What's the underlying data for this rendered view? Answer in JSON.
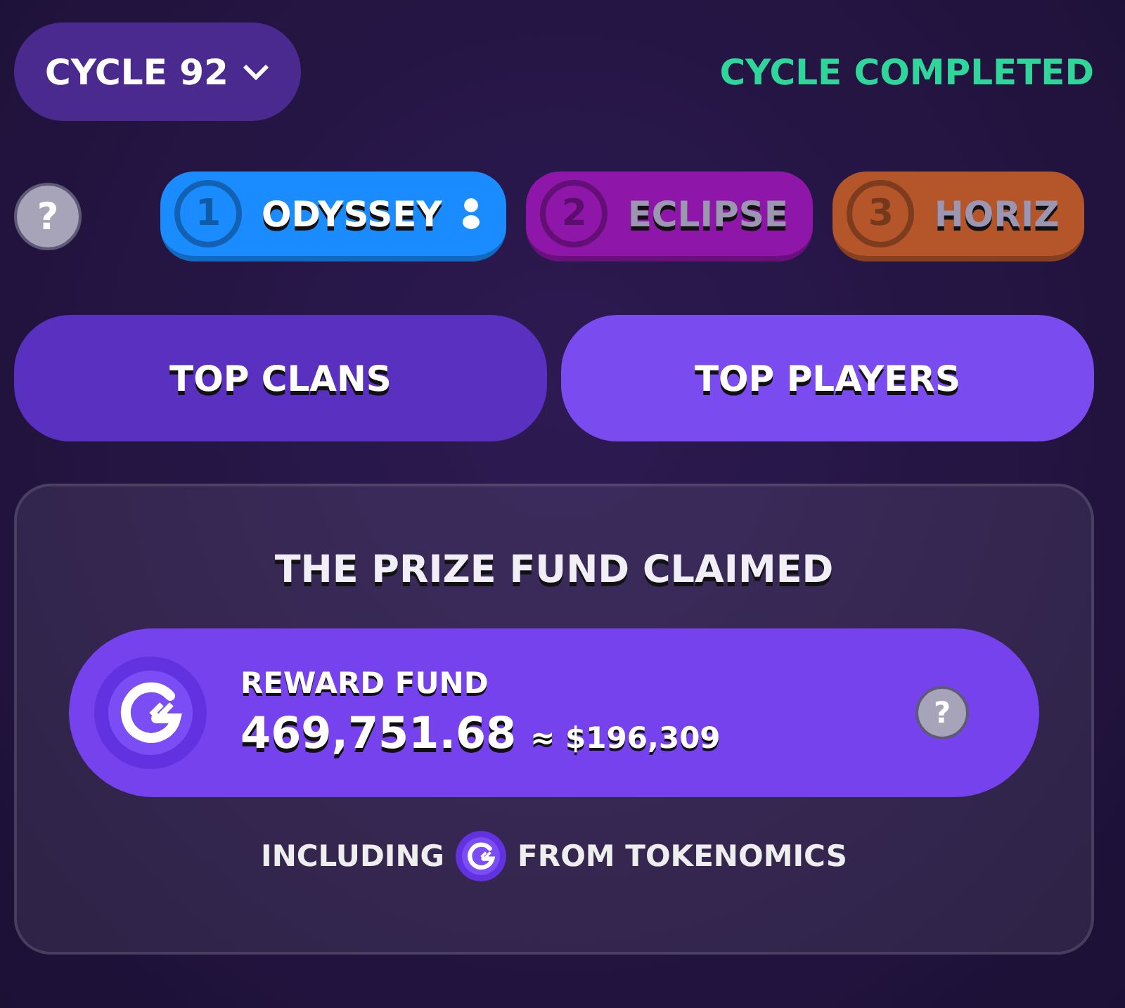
{
  "cycle": {
    "label": "CYCLE 92",
    "status": "CYCLE COMPLETED"
  },
  "help": "?",
  "leagues": [
    {
      "number": "1",
      "name": "ODYSSEY",
      "color": "#1a8cff",
      "selected": true
    },
    {
      "number": "2",
      "name": "ECLIPSE",
      "color": "#8e16a8",
      "selected": false
    },
    {
      "number": "3",
      "name": "HORIZ",
      "color": "#b4562a",
      "selected": false
    }
  ],
  "toggle": [
    {
      "label": "TOP CLANS",
      "selected": false
    },
    {
      "label": "TOP PLAYERS",
      "selected": true
    }
  ],
  "prize": {
    "title": "THE PRIZE FUND CLAIMED",
    "fund_label": "REWARD FUND",
    "amount": "469,751.68",
    "approx": "≈ $196,309",
    "help": "?",
    "including": "INCLUDING",
    "source": "FROM TOKENOMICS"
  }
}
